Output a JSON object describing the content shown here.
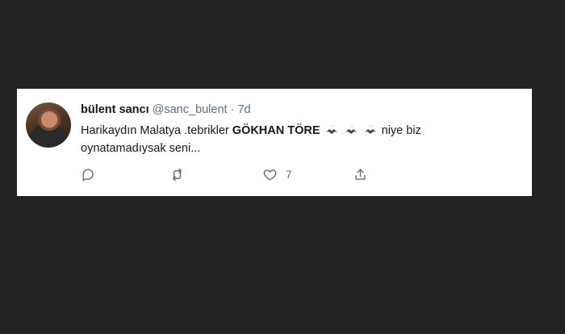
{
  "tweet": {
    "display_name": "bülent sancı",
    "handle": "@sanc_bulent",
    "separator": "·",
    "time": "7d",
    "text_before": "Harikaydın Malatya .tebrikler ",
    "text_bold": "GÖKHAN TÖRE",
    "emoji_name": "eagle-emoji",
    "emoji_count": 3,
    "text_after": " niye biz oynatamadıysak seni..."
  },
  "actions": {
    "reply_icon": "reply-icon",
    "retweet_icon": "retweet-icon",
    "like_icon": "heart-icon",
    "like_count": "7",
    "share_icon": "share-icon"
  },
  "colors": {
    "background": "#232323",
    "card": "#ffffff",
    "text": "#141823",
    "secondary": "#5b7083"
  }
}
